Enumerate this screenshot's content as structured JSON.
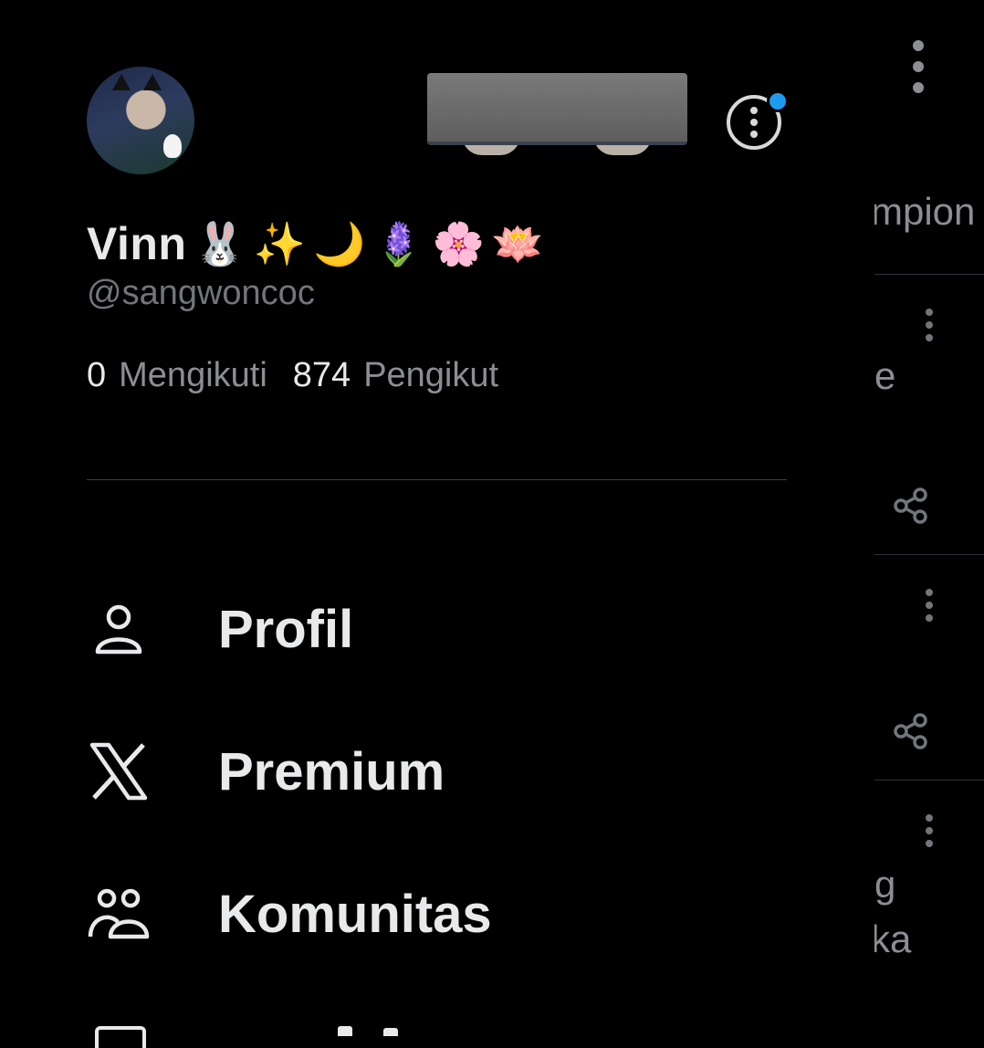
{
  "profile": {
    "name": "Vinn",
    "emojis": [
      "🐰",
      "✨",
      "🌙",
      "🪻",
      "🌸",
      "🪷"
    ],
    "handle": "@sangwoncoc",
    "following_count": "0",
    "following_label": "Mengikuti",
    "followers_count": "874",
    "followers_label": "Pengikut"
  },
  "menu": [
    {
      "label": "Profil",
      "icon": "person-icon"
    },
    {
      "label": "Premium",
      "icon": "x-logo-icon"
    },
    {
      "label": "Komunitas",
      "icon": "communities-icon"
    }
  ],
  "background_feed": {
    "snippets": [
      "mpion",
      "e",
      "g",
      "ka"
    ]
  },
  "colors": {
    "background": "#000000",
    "text_primary": "#e7e9ea",
    "text_secondary": "#71767b",
    "notification_dot": "#1d9bf0"
  }
}
